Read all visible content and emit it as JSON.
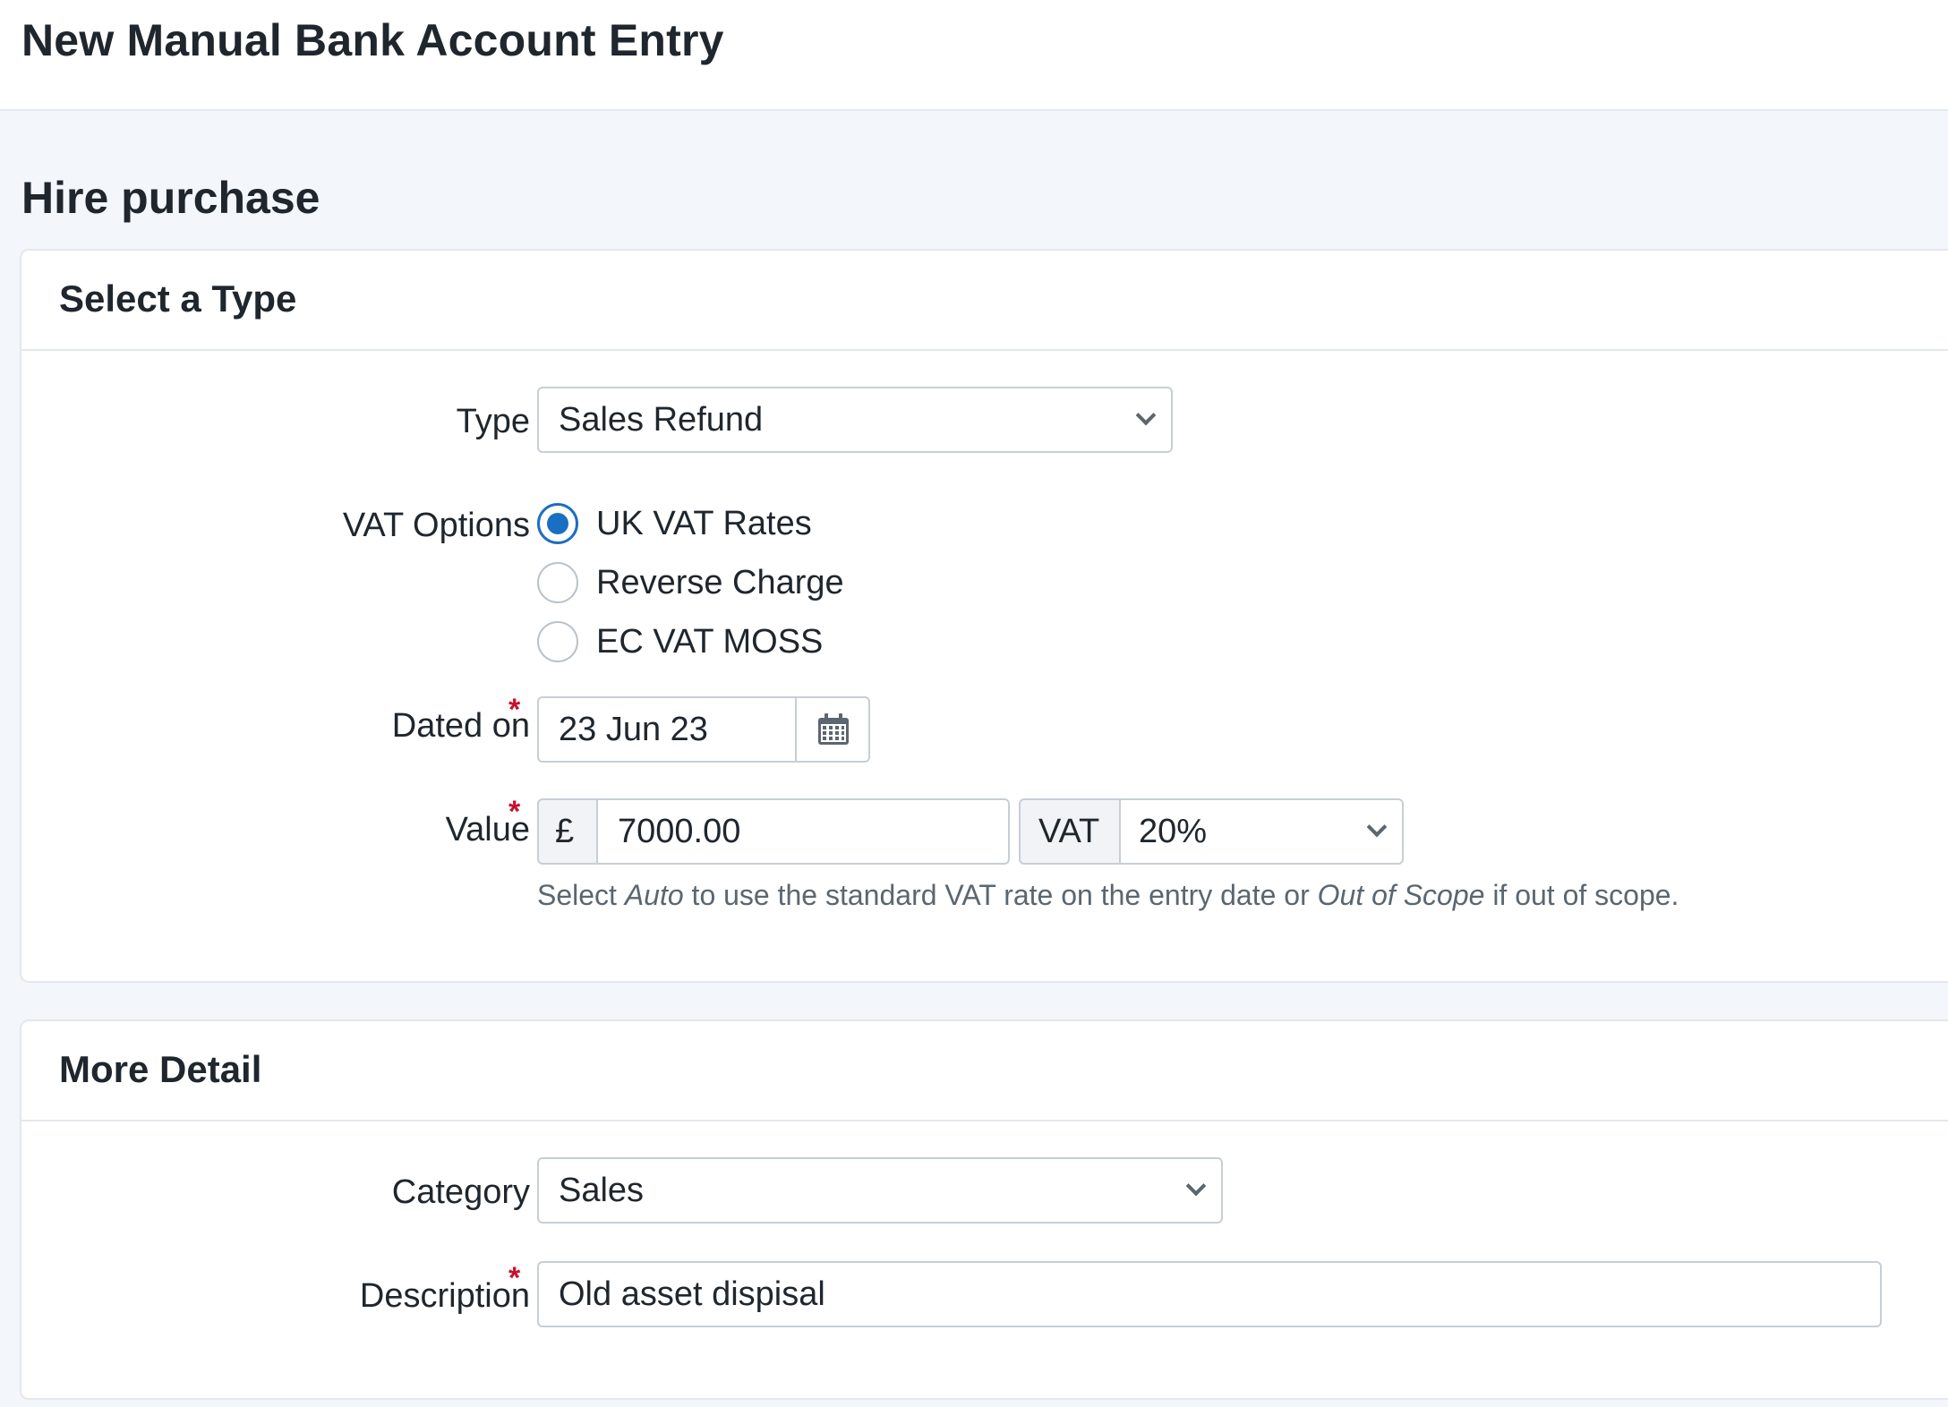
{
  "header": {
    "title": "New Manual Bank Account Entry"
  },
  "section": {
    "title": "Hire purchase"
  },
  "type_card": {
    "title": "Select a Type",
    "type_label": "Type",
    "type_value": "Sales Refund",
    "vat_options_label": "VAT Options",
    "vat_options": [
      {
        "label": "UK VAT Rates",
        "checked": true
      },
      {
        "label": "Reverse Charge",
        "checked": false
      },
      {
        "label": "EC VAT MOSS",
        "checked": false
      }
    ],
    "dated_on_label": "Dated on",
    "dated_on_value": "23 Jun 23",
    "value_label": "Value",
    "currency_symbol": "£",
    "value_amount": "7000.00",
    "vat_label": "VAT",
    "vat_value": "20%",
    "hint_prefix": "Select ",
    "hint_auto": "Auto",
    "hint_middle": " to use the standard VAT rate on the entry date or ",
    "hint_out_of_scope": "Out of Scope",
    "hint_suffix": " if out of scope.",
    "required_marker": "*"
  },
  "detail_card": {
    "title": "More Detail",
    "category_label": "Category",
    "category_value": "Sales",
    "description_label": "Description",
    "description_value": "Old asset dispisal"
  },
  "colors": {
    "accent": "#1b6fc2",
    "required": "#c8102e",
    "background": "#f3f6fa"
  },
  "icons": {
    "calendar": "calendar-icon",
    "dropdown": "chevron-down-icon"
  }
}
